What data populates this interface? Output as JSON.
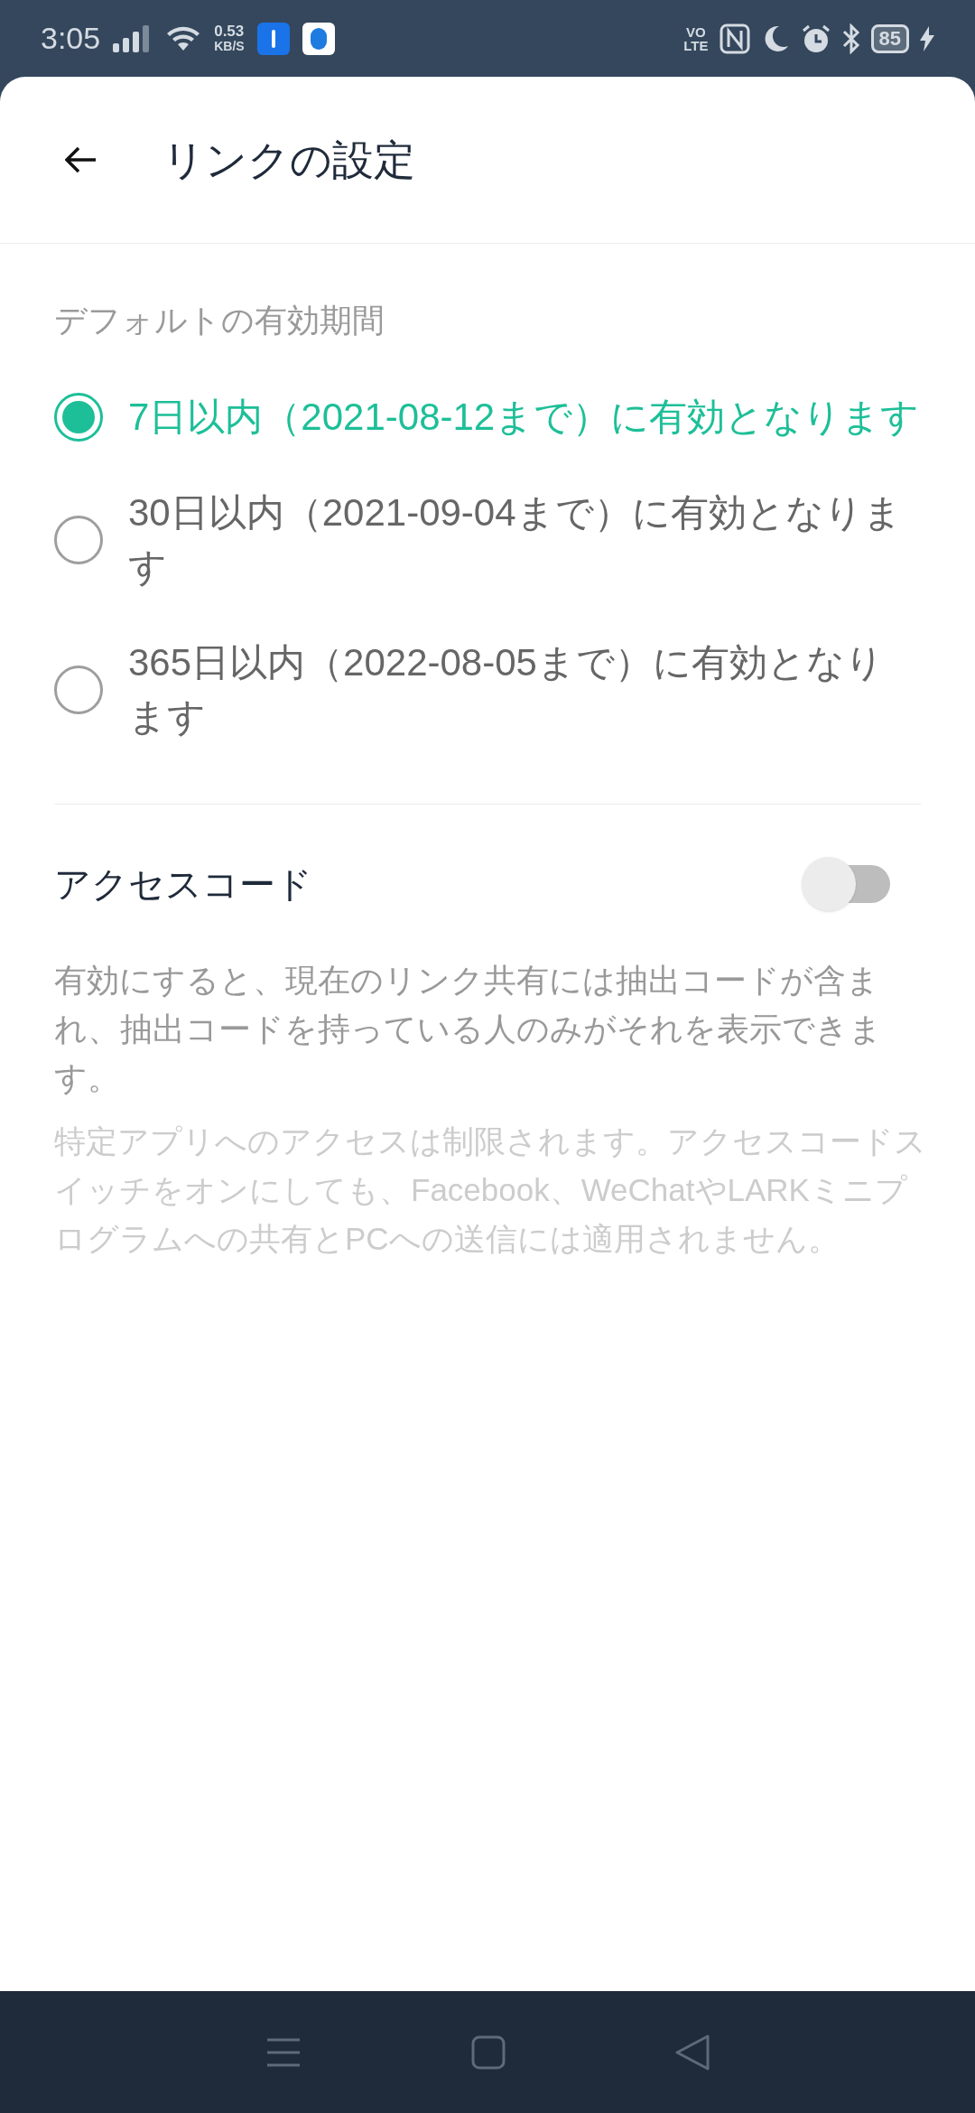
{
  "status_bar": {
    "time": "3:05",
    "speed_value": "0.53",
    "speed_unit": "KB/S",
    "volte_top": "VO",
    "volte_bottom": "LTE",
    "battery": "85"
  },
  "header": {
    "title": "リンクの設定"
  },
  "validity": {
    "label": "デフォルトの有効期間",
    "options": [
      {
        "label": "7日以内（2021-08-12まで）に有効となります",
        "selected": true
      },
      {
        "label": "30日以内（2021-09-04まで）に有効となります",
        "selected": false
      },
      {
        "label": "365日以内（2022-08-05まで）に有効となります",
        "selected": false
      }
    ]
  },
  "access_code": {
    "label": "アクセスコード",
    "on": false,
    "description": "有効にすると、現在のリンク共有には抽出コードが含まれ、抽出コードを持っている人のみがそれを表示できます。",
    "note": "特定アプリへのアクセスは制限されます。アクセスコードスイッチをオンにしても、Facebook、WeChatやLARKミニプログラムへの共有とPCへの送信には適用されません。"
  }
}
